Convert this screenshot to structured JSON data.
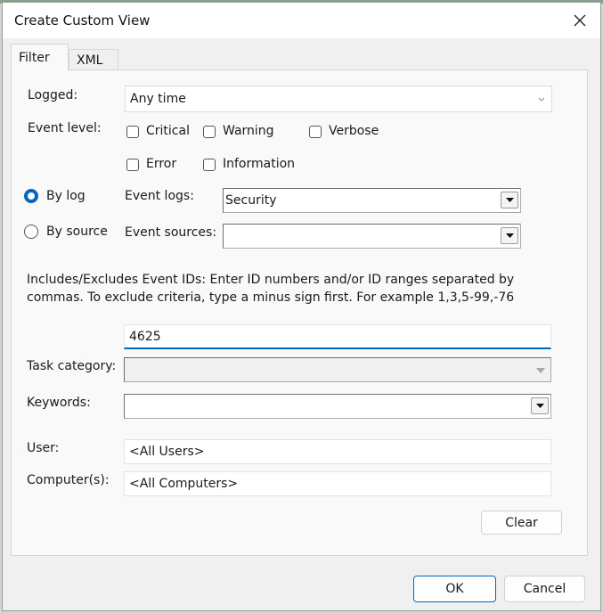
{
  "dialog": {
    "title": "Create Custom View",
    "tabs": [
      {
        "label": "Filter"
      },
      {
        "label": "XML"
      }
    ]
  },
  "filter": {
    "logged_label": "Logged:",
    "logged_value": "Any time",
    "event_level_label": "Event level:",
    "levels": {
      "critical": {
        "label": "Critical",
        "checked": false
      },
      "warning": {
        "label": "Warning",
        "checked": false
      },
      "verbose": {
        "label": "Verbose",
        "checked": false
      },
      "error": {
        "label": "Error",
        "checked": false
      },
      "information": {
        "label": "Information",
        "checked": false
      }
    },
    "by_log_label": "By log",
    "by_source_label": "By source",
    "selected_mode": "by_log",
    "event_logs_label": "Event logs:",
    "event_logs_value": "Security",
    "event_sources_label": "Event sources:",
    "event_sources_value": "",
    "description": "Includes/Excludes Event IDs: Enter ID numbers and/or ID ranges separated by commas. To exclude criteria, type a minus sign first. For example 1,3,5-99,-76",
    "event_ids_value": "4625",
    "task_category_label": "Task category:",
    "task_category_value": "",
    "keywords_label": "Keywords:",
    "keywords_value": "",
    "user_label": "User:",
    "user_value": "<All Users>",
    "computers_label": "Computer(s):",
    "computers_value": "<All Computers>",
    "clear_label": "Clear"
  },
  "footer": {
    "ok_label": "OK",
    "cancel_label": "Cancel"
  },
  "colors": {
    "accent": "#0067c0",
    "dialog_bg": "#f0f0f0",
    "panel_bg": "#f9f9f9"
  }
}
